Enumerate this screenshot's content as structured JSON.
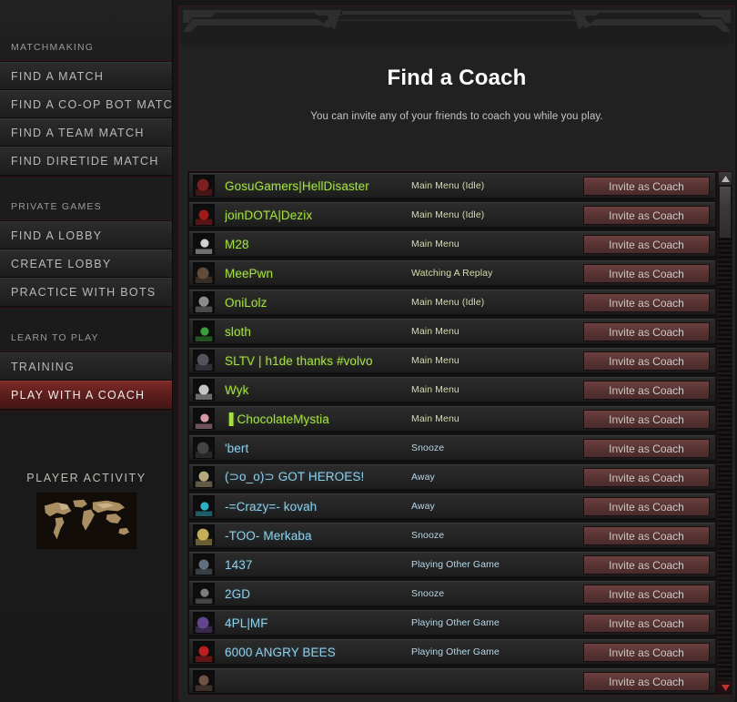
{
  "sidebar": {
    "sections": [
      {
        "label": "MATCHMAKING",
        "items": [
          {
            "label": "FIND A MATCH",
            "active": false
          },
          {
            "label": "FIND A CO-OP BOT MATCH",
            "active": false
          },
          {
            "label": "FIND A TEAM MATCH",
            "active": false
          },
          {
            "label": "FIND DIRETIDE MATCH",
            "active": false
          }
        ]
      },
      {
        "label": "PRIVATE GAMES",
        "items": [
          {
            "label": "FIND A LOBBY",
            "active": false
          },
          {
            "label": "CREATE LOBBY",
            "active": false
          },
          {
            "label": "PRACTICE WITH BOTS",
            "active": false
          }
        ]
      },
      {
        "label": "LEARN TO PLAY",
        "items": [
          {
            "label": "TRAINING",
            "active": false
          },
          {
            "label": "PLAY WITH A COACH",
            "active": true
          }
        ]
      }
    ],
    "player_activity": {
      "title": "PLAYER ACTIVITY"
    }
  },
  "header": {
    "title": "Find a Coach",
    "subtitle": "You can invite any of your friends to coach you while you play."
  },
  "friends": {
    "invite_label": "Invite as Coach",
    "rows": [
      {
        "name": "GosuGamers|HellDisaster",
        "status": "Main Menu (Idle)",
        "state": "online",
        "avatar": "#8b2222"
      },
      {
        "name": "joinDOTA|Dezix",
        "status": "Main Menu (Idle)",
        "state": "online",
        "avatar": "#b01c1c"
      },
      {
        "name": "M28",
        "status": "Main Menu",
        "state": "online",
        "avatar": "#e8e8e8"
      },
      {
        "name": "MeePwn",
        "status": "Watching A Replay",
        "state": "online",
        "avatar": "#6a5340"
      },
      {
        "name": "OniLolz",
        "status": "Main Menu (Idle)",
        "state": "online",
        "avatar": "#9a9a9a"
      },
      {
        "name": "sloth",
        "status": "Main Menu",
        "state": "online",
        "avatar": "#3fae3f"
      },
      {
        "name": "SLTV | h1de thanks #volvo",
        "status": "Main Menu",
        "state": "online",
        "avatar": "#5a5a6a"
      },
      {
        "name": "Wyk",
        "status": "Main Menu",
        "state": "online",
        "avatar": "#d8d8d8"
      },
      {
        "name": "▐ ChocolateMystia",
        "status": "Main Menu",
        "state": "online",
        "avatar": "#e8a8b8"
      },
      {
        "name": "'bert",
        "status": "Snooze",
        "state": "offline",
        "avatar": "#4a4a4a"
      },
      {
        "name": "(⊃o_o)⊃ GOT HEROES!",
        "status": "Away",
        "state": "offline",
        "avatar": "#c9b98a"
      },
      {
        "name": "-=Crazy=- kovah",
        "status": "Away",
        "state": "offline",
        "avatar": "#2fc4d8"
      },
      {
        "name": "-TOO- Merkaba",
        "status": "Snooze",
        "state": "offline",
        "avatar": "#d8c060"
      },
      {
        "name": "1437",
        "status": "Playing Other Game",
        "state": "offline",
        "avatar": "#6a7a8a"
      },
      {
        "name": "2GD",
        "status": "Snooze",
        "state": "offline",
        "avatar": "#8a8a8a"
      },
      {
        "name": "4PL|MF",
        "status": "Playing Other Game",
        "state": "offline",
        "avatar": "#6a4a9a"
      },
      {
        "name": "6000 ANGRY BEES",
        "status": "Playing Other Game",
        "state": "offline",
        "avatar": "#d02020"
      }
    ],
    "partial_row": {
      "avatar": "#7a5a4a"
    }
  },
  "scrollbar": {
    "up_arrow": "chevron-up-icon",
    "down_arrow": "chevron-down-icon"
  }
}
